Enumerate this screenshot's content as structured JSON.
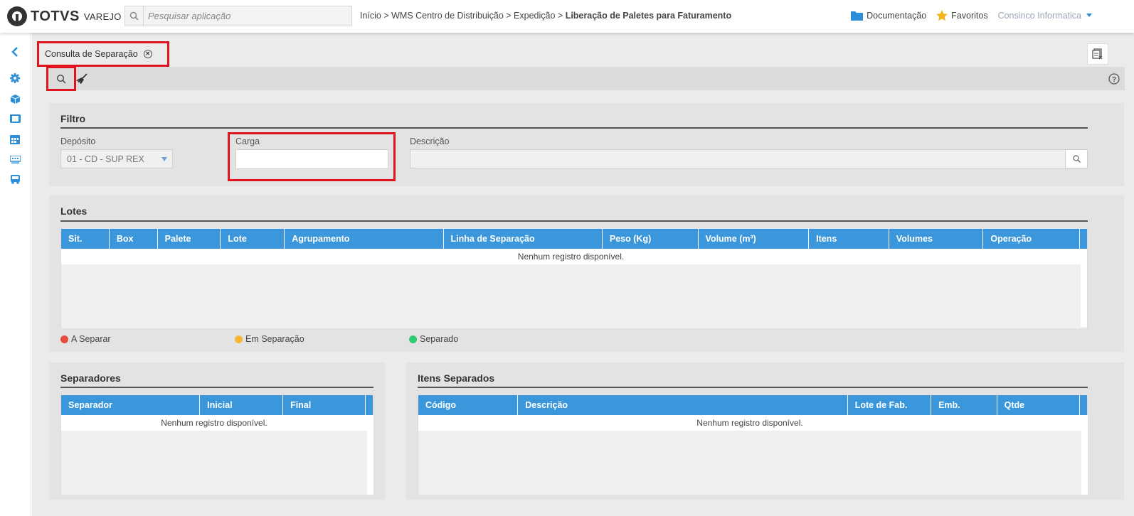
{
  "header": {
    "brand": "TOTVS",
    "brand_sub": "VAREJO",
    "search_placeholder": "Pesquisar aplicação",
    "breadcrumb_path": "Início > WMS Centro de Distribuição > Expedição > ",
    "breadcrumb_current": "Liberação de Paletes para Faturamento",
    "documentation": "Documentação",
    "favorites": "Favoritos",
    "user": "Consinco Informatica"
  },
  "tab": {
    "label": "Consulta de Separação"
  },
  "filter": {
    "title": "Filtro",
    "deposito_label": "Depósito",
    "deposito_value": "01 - CD - SUP REX",
    "carga_label": "Carga",
    "carga_value": "",
    "descricao_label": "Descrição",
    "descricao_value": ""
  },
  "lotes": {
    "title": "Lotes",
    "columns": [
      "Sit.",
      "Box",
      "Palete",
      "Lote",
      "Agrupamento",
      "Linha de Separação",
      "Peso (Kg)",
      "Volume (m³)",
      "Itens",
      "Volumes",
      "Operação"
    ],
    "empty": "Nenhum registro disponível.",
    "legend": [
      {
        "label": "A Separar",
        "color": "#e74c3c"
      },
      {
        "label": "Em Separação",
        "color": "#f5b735"
      },
      {
        "label": "Separado",
        "color": "#2ecc71"
      }
    ]
  },
  "separadores": {
    "title": "Separadores",
    "columns": [
      "Separador",
      "Inicial",
      "Final"
    ],
    "empty": "Nenhum registro disponível."
  },
  "itens": {
    "title": "Itens Separados",
    "columns": [
      "Código",
      "Descrição",
      "Lote de Fab.",
      "Emb.",
      "Qtde"
    ],
    "empty": "Nenhum registro disponível."
  },
  "colors": {
    "accent": "#3a97dc",
    "highlight": "#e0141e"
  }
}
